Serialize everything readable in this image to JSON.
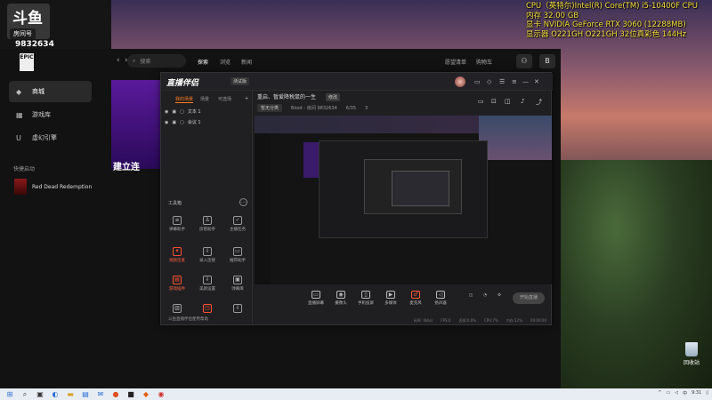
{
  "overlay": {
    "cpu": "CPU（英特尔)Intel(R) Core(TM) i5-10400F CPU",
    "memory": "内存  32.00 GB",
    "gpu": "显卡  NVIDIA GeForce RTX 3060 (12288MB)",
    "monitor": "显示器  O221GH O221GH 32位真彩色 144Hz"
  },
  "streamer": {
    "logo": "斗鱼",
    "room_label": "房间号",
    "room_number": "9832634"
  },
  "epic": {
    "logo": "EPIC",
    "search_placeholder": "搜索",
    "tabs": [
      "探索",
      "浏览",
      "新闻"
    ],
    "right_links": [
      "愿望清单",
      "购物车"
    ],
    "user_initial": "B",
    "sidebar": [
      "商城",
      "游戏库",
      "虚幻引擎"
    ],
    "quick_launch": "快捷启动",
    "game": "Red Dead Redemption",
    "banner_text": "建立连"
  },
  "live_app": {
    "title": "直播伴侣",
    "beta": "测试版",
    "scene_tabs": [
      "我的场景",
      "场景",
      "可选场"
    ],
    "sources": [
      "文本 1",
      "会议 1"
    ],
    "room_title": "重启、暂爱降税鼠的一生",
    "room_tag": "修改",
    "category": "暂无分类",
    "room_meta_1": "Bloot - 房间 9832634",
    "room_meta_2": "6/35",
    "room_meta_3": "3",
    "tools_header": "工具箱",
    "tools": [
      {
        "label": "弹幕助手",
        "hot": false
      },
      {
        "label": "房管助手",
        "hot": false
      },
      {
        "label": "主播任务",
        "hot": false
      },
      {
        "label": "视频连麦",
        "hot": true
      },
      {
        "label": "录入连接",
        "hot": false
      },
      {
        "label": "推荐助手",
        "hot": false
      },
      {
        "label": "游戏插件",
        "hot": true
      },
      {
        "label": "美颜设置",
        "hot": false
      },
      {
        "label": "弹幕库",
        "hot": false
      }
    ],
    "bottom_note": "斗鱼直播伴侣使用帮助",
    "controls": [
      "直播屏幕",
      "摄像头",
      "手机投屏",
      "多媒体",
      "麦克风",
      "扬声器"
    ],
    "go_live": "开始直播",
    "status": [
      "码率: 0kb/s",
      "FPS:0",
      "丢帧:0.0%",
      "CPU:7%",
      "内存:12%",
      "00:00:00"
    ]
  },
  "desktop": {
    "recycle_bin": "回收站"
  },
  "taskbar": {
    "lang": "中",
    "time": "9:31"
  }
}
